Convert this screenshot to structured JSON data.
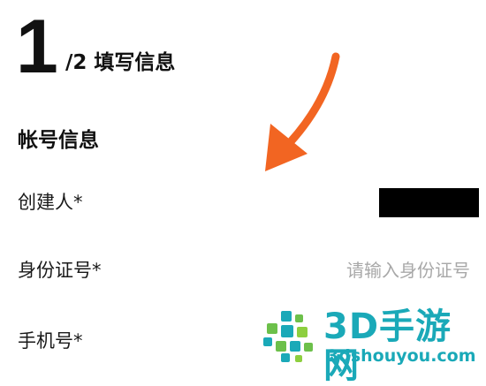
{
  "header": {
    "step_number": "1",
    "step_title": "/2 填写信息"
  },
  "section": {
    "title": "帐号信息"
  },
  "fields": {
    "creator": {
      "label": "创建人*"
    },
    "id_card": {
      "label": "身份证号*",
      "placeholder": "请输入身份证号"
    },
    "phone": {
      "label": "手机号*"
    }
  },
  "annotation": {
    "arrow_color": "#f26522",
    "arrow_icon": "arrow-pointing-down-left-icon"
  },
  "watermark": {
    "brand": "3D手游网",
    "url": "3dshouyou.com",
    "color": "#1aa9b8",
    "logo_icon": "pixel-dots-logo-icon"
  }
}
